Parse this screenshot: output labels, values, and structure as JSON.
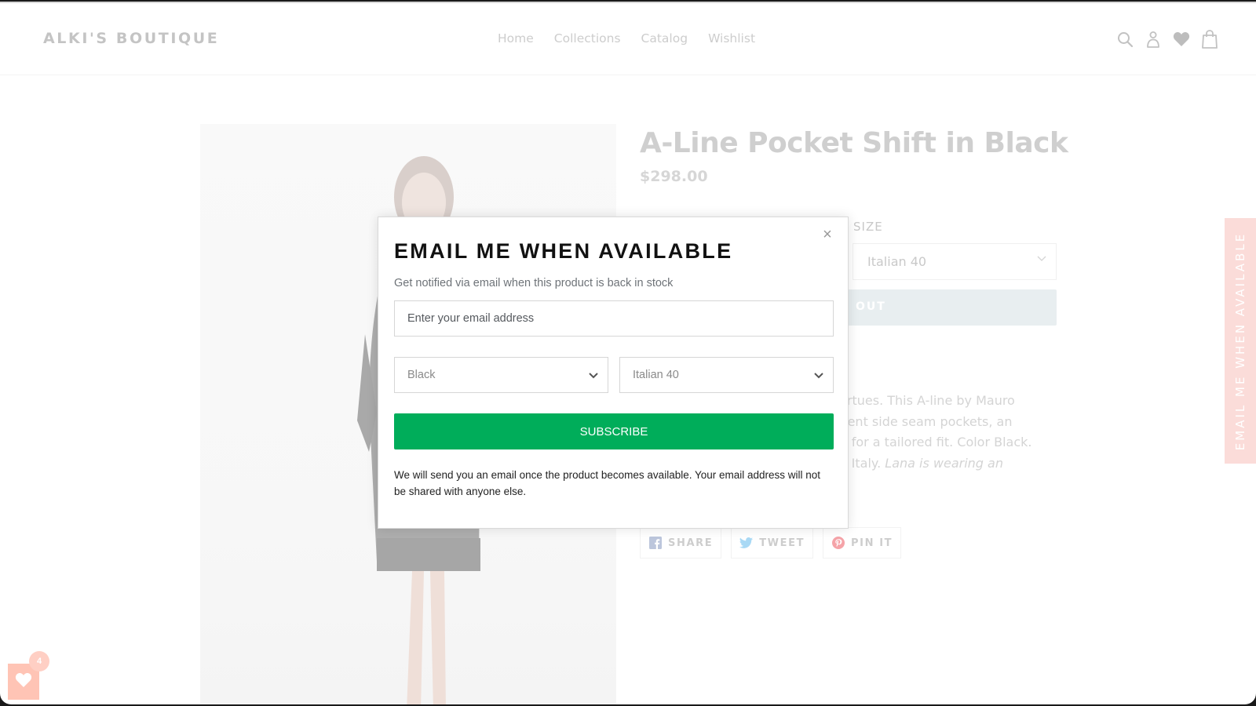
{
  "header": {
    "logo": "ALKI'S BOUTIQUE",
    "nav": [
      "Home",
      "Collections",
      "Catalog",
      "Wishlist"
    ],
    "icons": [
      "search-icon",
      "account-icon",
      "wishlist-heart-icon",
      "cart-bag-icon"
    ]
  },
  "product": {
    "title": "A-Line Pocket Shift in Black",
    "price": "$298.00",
    "size_label": "SIZE",
    "size_value": "Italian 40",
    "sold_out_label": "OUT",
    "description": {
      "line1": "virtues. This A-line by Mauro",
      "line2": "nient side seam pockets, an",
      "line3": "ts for a tailored fit. Color Black.",
      "line4_plain": "in Italy. ",
      "line4_italic": "Lana is wearing an"
    },
    "share": [
      {
        "label": "SHARE",
        "icon": "facebook-icon",
        "color": "#3b5998"
      },
      {
        "label": "TWEET",
        "icon": "twitter-icon",
        "color": "#1da1f2"
      },
      {
        "label": "PIN IT",
        "icon": "pinterest-icon",
        "color": "#e60023"
      }
    ]
  },
  "side_tab": {
    "label": "EMAIL ME WHEN AVAILABLE",
    "color": "#fbdcd9"
  },
  "wishlist_float": {
    "count": "4",
    "color": "#ffc4b5"
  },
  "modal": {
    "title": "EMAIL ME WHEN AVAILABLE",
    "subtitle": "Get notified via email when this product is back in stock",
    "email_placeholder": "Enter your email address",
    "email_value": "",
    "color_select": "Black",
    "size_select": "Italian 40",
    "subscribe_label": "SUBSCRIBE",
    "subscribe_color": "#00ad5a",
    "note": "We will send you an email once the product becomes available. Your email address will not be shared with anyone else.",
    "close_label": "×"
  }
}
